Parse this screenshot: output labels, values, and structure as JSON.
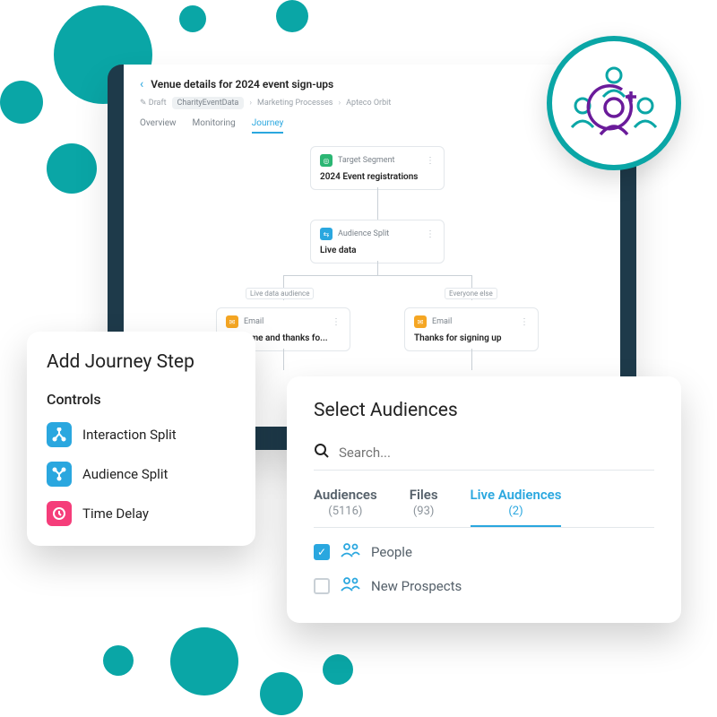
{
  "page": {
    "title": "Venue details for 2024 event sign-ups",
    "breadcrumbs": [
      "CharityEventData",
      "Marketing Processes",
      "Apteco Orbit"
    ],
    "draft_label": "Draft",
    "tabs": [
      "Overview",
      "Monitoring",
      "Journey"
    ],
    "active_tab": "Journey"
  },
  "flow": {
    "target": {
      "label": "Target Segment",
      "body": "2024 Event registrations"
    },
    "split": {
      "label": "Audience Split",
      "body": "Live data"
    },
    "branch_left": "Live data audience",
    "branch_right": "Everyone else",
    "email_left": {
      "label": "Email",
      "body": "Welcome and thanks fo..."
    },
    "email_right": {
      "label": "Email",
      "body": "Thanks for signing up"
    }
  },
  "add_step": {
    "title": "Add Journey Step",
    "section": "Controls",
    "items": [
      {
        "label": "Interaction Split",
        "color": "blue",
        "icon": "branch"
      },
      {
        "label": "Audience Split",
        "color": "blue",
        "icon": "split"
      },
      {
        "label": "Time Delay",
        "color": "pink",
        "icon": "clock"
      }
    ]
  },
  "select_audiences": {
    "title": "Select Audiences",
    "search_placeholder": "Search...",
    "tabs": [
      {
        "name": "Audiences",
        "count": "(5116)"
      },
      {
        "name": "Files",
        "count": "(93)"
      },
      {
        "name": "Live Audiences",
        "count": "(2)"
      }
    ],
    "active_tab": "Live Audiences",
    "rows": [
      {
        "label": "People",
        "checked": true
      },
      {
        "label": "New Prospects",
        "checked": false
      }
    ]
  }
}
